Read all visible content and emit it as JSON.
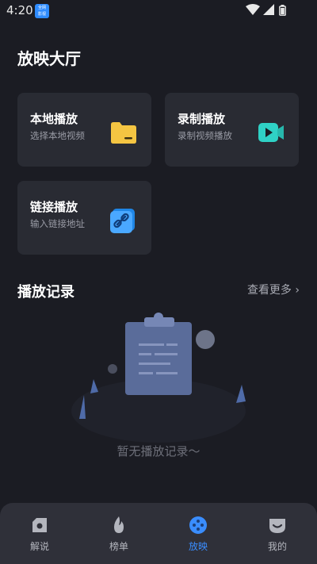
{
  "status": {
    "time": "4:20",
    "app_icon_text": "全网\n影视"
  },
  "page": {
    "title": "放映大厅"
  },
  "cards": [
    {
      "title": "本地播放",
      "subtitle": "选择本地视频",
      "icon": "folder-icon"
    },
    {
      "title": "录制播放",
      "subtitle": "录制视频播放",
      "icon": "video-camera-icon"
    },
    {
      "title": "链接播放",
      "subtitle": "输入链接地址",
      "icon": "link-icon"
    }
  ],
  "history": {
    "title": "播放记录",
    "more_label": "查看更多",
    "empty_text": "暂无播放记录～"
  },
  "tabs": [
    {
      "label": "解说",
      "icon": "commentary-icon",
      "active": false
    },
    {
      "label": "榜单",
      "icon": "flame-icon",
      "active": false
    },
    {
      "label": "放映",
      "icon": "film-reel-icon",
      "active": true
    },
    {
      "label": "我的",
      "icon": "smile-face-icon",
      "active": false
    }
  ],
  "colors": {
    "background": "#1b1c23",
    "card": "#292b33",
    "tab_bar": "#2f3039",
    "accent": "#3a8dff",
    "folder": "#f4c542",
    "camera": "#2fd1c5"
  }
}
